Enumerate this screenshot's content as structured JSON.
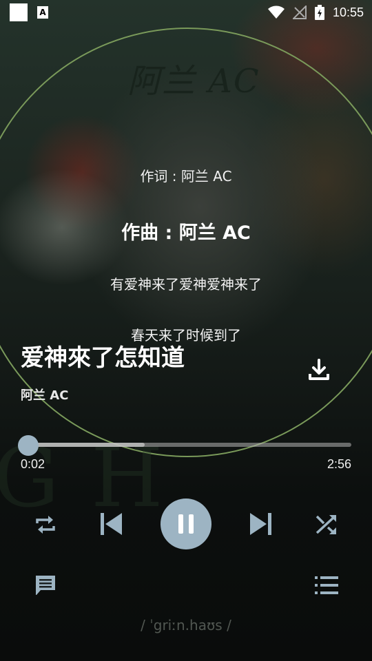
{
  "status_bar": {
    "time": "10:55",
    "icons": [
      "notification-square-icon",
      "a-app-icon",
      "wifi-icon",
      "no-signal-icon",
      "battery-charging-icon"
    ]
  },
  "background": {
    "brand_text": "阿兰 AC",
    "phonetic": "/ ˈgriːn.haʊs /"
  },
  "lyrics": [
    {
      "text": "作词 : 阿兰 AC",
      "state": "normal"
    },
    {
      "text": "作曲 : 阿兰 AC",
      "state": "current"
    },
    {
      "text": "有爱神来了爱神爱神来了",
      "state": "normal"
    },
    {
      "text": "春天来了时候到了",
      "state": "normal"
    }
  ],
  "song": {
    "title": "爱神來了怎知道",
    "artist": "阿兰 AC"
  },
  "progress": {
    "elapsed": "0:02",
    "total": "2:56",
    "fraction": 0.011
  },
  "controls": {
    "repeat": "repeat-icon",
    "previous": "skip-previous-icon",
    "play_pause": "pause-icon",
    "next": "skip-next-icon",
    "shuffle": "shuffle-icon",
    "comments": "comment-icon",
    "playlist": "playlist-icon",
    "download": "download-icon"
  },
  "colors": {
    "accent": "#9db4c3",
    "arc": "#7a9a5a"
  }
}
